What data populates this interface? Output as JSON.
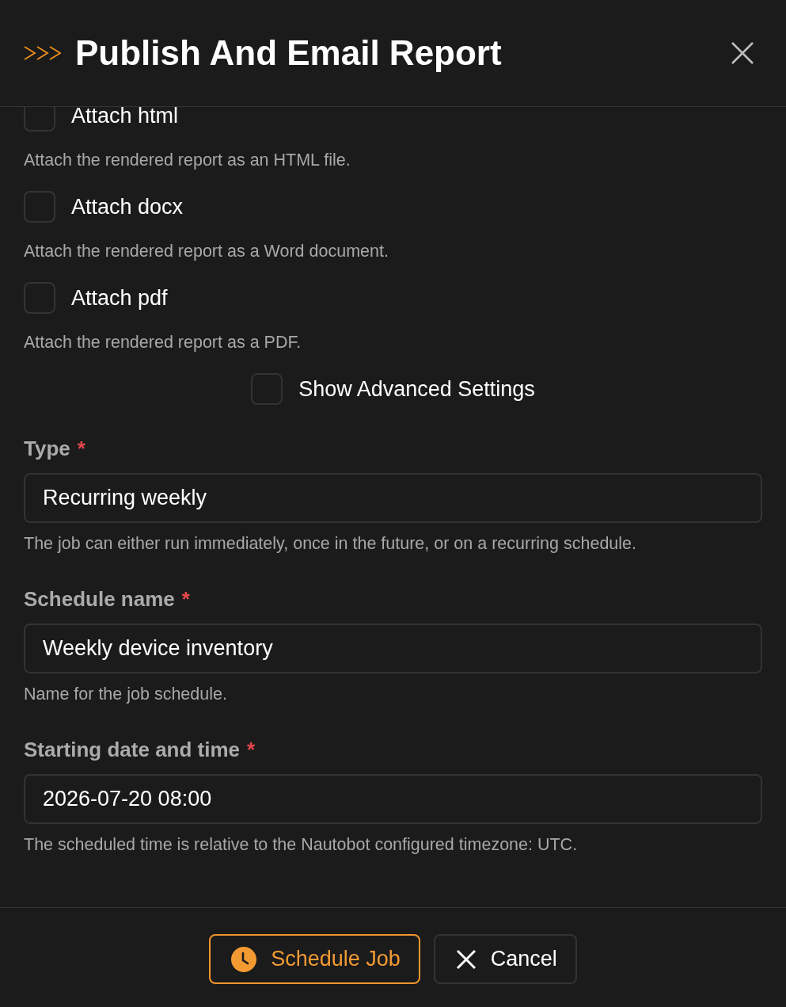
{
  "dialog": {
    "title": "Publish And Email Report"
  },
  "options": [
    {
      "label": "Attach html",
      "checked": false,
      "help": "Attach the rendered report as an HTML file."
    },
    {
      "label": "Attach docx",
      "checked": false,
      "help": "Attach the rendered report as a Word document."
    },
    {
      "label": "Attach pdf",
      "checked": false,
      "help": "Attach the rendered report as a PDF."
    }
  ],
  "advanced_toggle": {
    "label": "Show Advanced Settings",
    "checked": false
  },
  "fields": [
    {
      "label": "Type",
      "required_mark": "*",
      "value": "Recurring weekly",
      "help": "The job can either run immediately, once in the future, or on a recurring schedule."
    },
    {
      "label": "Schedule name",
      "required_mark": "*",
      "value": "Weekly device inventory",
      "help": "Name for the job schedule."
    },
    {
      "label": "Starting date and time",
      "required_mark": "*",
      "value": "2026-07-20 08:00",
      "help": "The scheduled time is relative to the Nautobot configured timezone: UTC."
    }
  ],
  "buttons": [
    {
      "label": "Schedule Job",
      "kind": "primary"
    },
    {
      "label": "Cancel",
      "kind": "secondary"
    }
  ]
}
